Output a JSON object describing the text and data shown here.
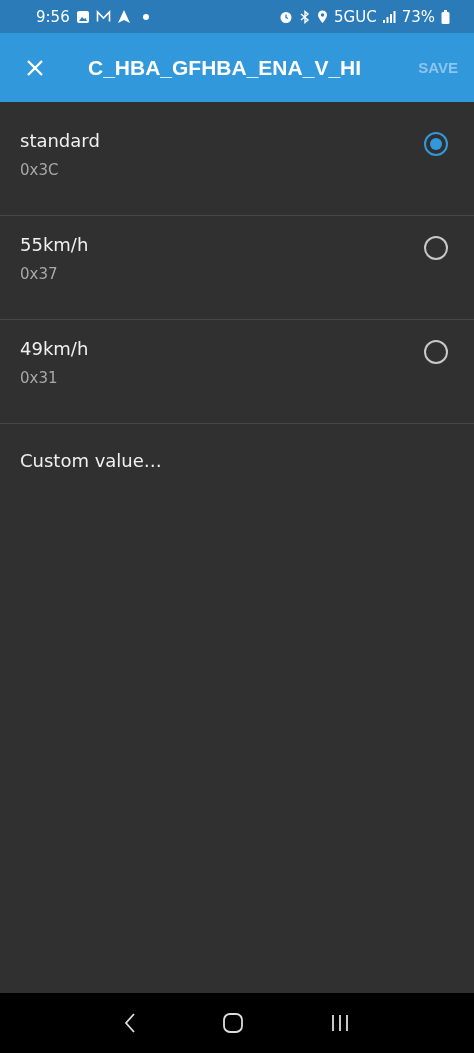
{
  "status_bar": {
    "time": "9:56",
    "network": "5GUC",
    "battery": "73%"
  },
  "app_bar": {
    "title": "C_HBA_GFHBA_ENA_V_HI",
    "action": {
      "label": "SAVE",
      "disabled": true
    }
  },
  "options": [
    {
      "label": "standard",
      "value": "0x3C",
      "selected": true
    },
    {
      "label": "55km/h",
      "value": "0x37",
      "selected": false
    },
    {
      "label": "49km/h",
      "value": "0x31",
      "selected": false
    }
  ],
  "custom_option": {
    "label": "Custom value…"
  }
}
